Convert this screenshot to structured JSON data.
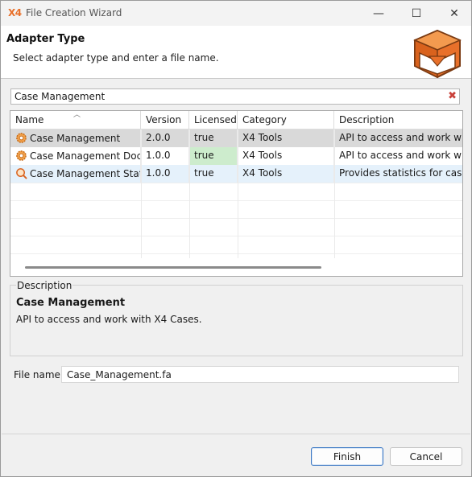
{
  "window": {
    "app_logo": "X4",
    "title": "File Creation Wizard",
    "minimize_glyph": "—",
    "maximize_glyph": "☐",
    "close_glyph": "✕"
  },
  "header": {
    "title": "Adapter Type",
    "subtitle": "Select adapter type and enter a file name."
  },
  "filter": {
    "value": "Case Management",
    "clear_glyph": "✖"
  },
  "table": {
    "columns": [
      "Name",
      "Version",
      "Licensed",
      "Category",
      "Description"
    ],
    "rows": [
      {
        "name": "Case Management",
        "version": "2.0.0",
        "licensed": "true",
        "category": "X4 Tools",
        "description": "API to access and work with X",
        "icon": "gear-icon"
      },
      {
        "name": "Case Management Doc...",
        "version": "1.0.0",
        "licensed": "true",
        "category": "X4 Tools",
        "description": "API to access and work with c",
        "icon": "gear-icon"
      },
      {
        "name": "Case Management Stati...",
        "version": "1.0.0",
        "licensed": "true",
        "category": "X4 Tools",
        "description": "Provides statistics for case pro",
        "icon": "magnifier-icon"
      }
    ]
  },
  "description": {
    "legend": "Description",
    "title": "Case Management",
    "text": "API to access and work with X4 Cases."
  },
  "file_name": {
    "label": "File name:",
    "value": "Case_Management.fa"
  },
  "buttons": {
    "finish": "Finish",
    "cancel": "Cancel"
  },
  "colors": {
    "accent": "#e8702a",
    "selected_row": "#d9d9d9",
    "hover_row": "#e5f1fb",
    "licensed_highlight": "#cdeccd",
    "default_button_border": "#3b78c4"
  }
}
